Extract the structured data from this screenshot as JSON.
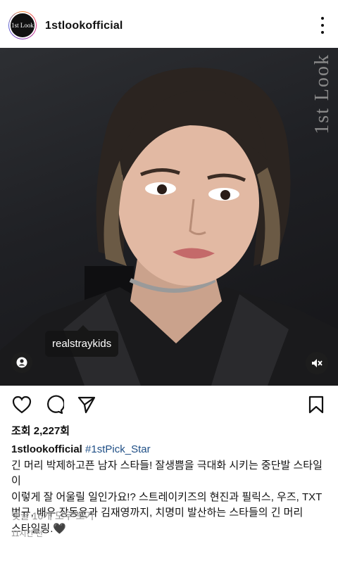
{
  "header": {
    "username": "1stlookofficial",
    "avatar_text": "1st Look",
    "more_icon": "more-vertical-icon"
  },
  "media": {
    "watermark": "1st Look",
    "tag_label": "realstraykids",
    "user_tag_icon": "user-icon",
    "mute_icon": "speaker-muted-icon"
  },
  "actions": {
    "like_icon": "heart-icon",
    "comment_icon": "comment-icon",
    "share_icon": "send-icon",
    "save_icon": "bookmark-icon"
  },
  "post": {
    "views": "조회 2,227회",
    "caption_username": "1stlookofficial",
    "caption_hashtag": "#1stPick_Star",
    "caption_line1": "긴 머리 박제하고픈 남자 스타들! 잘생쁨을 극대화 시키는 중단발 스타일이",
    "caption_line2": "이렇게 잘 어울릴 일인가요!? 스트레이키즈의 현진과 필릭스, 우즈, TXT",
    "caption_line3": "범규, 배우 장동윤과 김재영까지, 치명미 발산하는 스타들의 긴 머리",
    "caption_line4": "스타일링.🖤",
    "comments_link": "댓글 16개 모두 보기",
    "time_ago": "11시간 전"
  },
  "colors": {
    "hashtag": "#1f4f86",
    "secondary_text": "#8e8e8e"
  }
}
